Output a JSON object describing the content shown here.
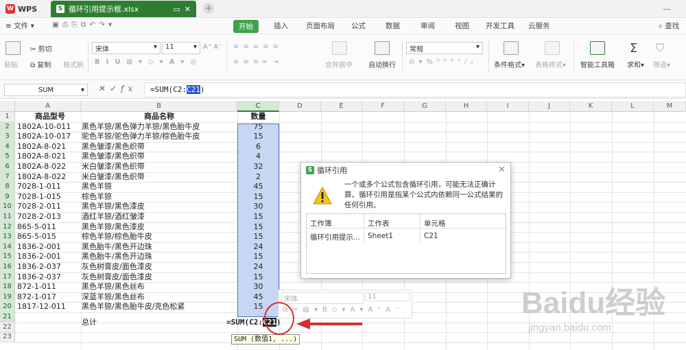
{
  "titlebar": {
    "wps_label": "WPS",
    "file_tab": "循环引用提示框.xlsx"
  },
  "menu": {
    "file": "文件",
    "tabs": [
      "开始",
      "插入",
      "页面布局",
      "公式",
      "数据",
      "审阅",
      "视图",
      "开发工具",
      "云服务"
    ],
    "search": "查找"
  },
  "ribbon": {
    "paste": "粘贴",
    "cut": "剪切",
    "copy": "复制",
    "format_painter": "格式刷",
    "font_name": "宋体",
    "font_size": "11",
    "merge_center": "合并居中",
    "wrap": "自动换行",
    "number_format": "常规",
    "conditional_format": "条件格式",
    "table_style": "表格样式",
    "smart_toolbox": "智能工具箱",
    "sum": "求和",
    "filter": "筛选"
  },
  "formula_bar": {
    "name_box": "SUM",
    "formula_prefix": "=SUM(C2:",
    "formula_selected": "C21",
    "formula_suffix": ")"
  },
  "columns": [
    "A",
    "B",
    "C",
    "D",
    "E",
    "F",
    "G",
    "H",
    "I",
    "J",
    "K",
    "L",
    "M"
  ],
  "rows": [
    "1",
    "2",
    "3",
    "4",
    "5",
    "6",
    "7",
    "8",
    "9",
    "10",
    "11",
    "12",
    "13",
    "14",
    "15",
    "16",
    "17",
    "18",
    "19",
    "20",
    "21",
    "22",
    "23"
  ],
  "headers": {
    "model": "商品型号",
    "name": "商品名称",
    "qty": "数量"
  },
  "table_rows": [
    [
      "1802A-10-011",
      "黑色羊猄/黑色弹力羊猄/黑色胎牛皮",
      "75"
    ],
    [
      "1802A-10-017",
      "驼色羊猄/驼色弹力羊猄/棕色胎牛皮",
      "15"
    ],
    [
      "1802A-8-021",
      "黑色皱漆/黑色织带",
      "6"
    ],
    [
      "1802A-8-021",
      "黑色皱漆/黑色织带",
      "4"
    ],
    [
      "1802A-8-022",
      "米白皱漆/黑色织带",
      "32"
    ],
    [
      "1802A-8-022",
      "米白皱漆/黑色织带",
      "2"
    ],
    [
      "7028-1-011",
      "黑色羊猄",
      "45"
    ],
    [
      "7028-1-015",
      "棕色羊猄",
      "15"
    ],
    [
      "7028-2-011",
      "黑色羊猄/黑色漆皮",
      "30"
    ],
    [
      "7028-2-013",
      "酒红羊猄/酒红皱漆",
      "15"
    ],
    [
      "865-5-011",
      "黑色羊猄/黑色漆皮",
      "15"
    ],
    [
      "865-5-015",
      "棕色羊猄/棕色胎牛皮",
      "15"
    ],
    [
      "1836-2-001",
      "黑色胎牛/黑色开边珠",
      "24"
    ],
    [
      "1836-2-001",
      "黑色胎牛/黑色开边珠",
      "15"
    ],
    [
      "1836-2-037",
      "灰色树膏皮/面色漆皮",
      "24"
    ],
    [
      "1836-2-037",
      "灰色树膏皮/面色漆皮",
      "15"
    ],
    [
      "872-1-011",
      "黑色羊猄/黑色丝布",
      "30"
    ],
    [
      "872-1-017",
      "深蓝羊猄/黑色丝布",
      "45"
    ],
    [
      "1817-12-011",
      "黑色羊猄/黑色胎牛皮/克色松紧",
      "15"
    ]
  ],
  "total_label": "总计",
  "editing": {
    "prefix": "=SUM(C2:",
    "selected": "C21",
    "suffix": ")"
  },
  "tooltip": "SUM (数值1, ...)",
  "mini_toolbar": {
    "font": "宋体",
    "size": "11"
  },
  "dialog": {
    "title": "循环引用",
    "message": "一个或多个公式包含循环引用，可能无法正确计算。循环引用是指某个公式内依赖同一公式结果的任何引用。",
    "col_workbook": "工作簿",
    "col_sheet": "工作表",
    "col_cell": "单元格",
    "row_workbook": "循环引用提示...",
    "row_sheet": "Sheet1",
    "row_cell": "C21"
  },
  "watermark": {
    "brand": "Baidu经验",
    "url": "jingyan.baidu.com"
  },
  "colors": {
    "accent_green": "#3fa34d",
    "selection_blue": "#c7d6f2",
    "annotation_red": "#d32f2f"
  }
}
